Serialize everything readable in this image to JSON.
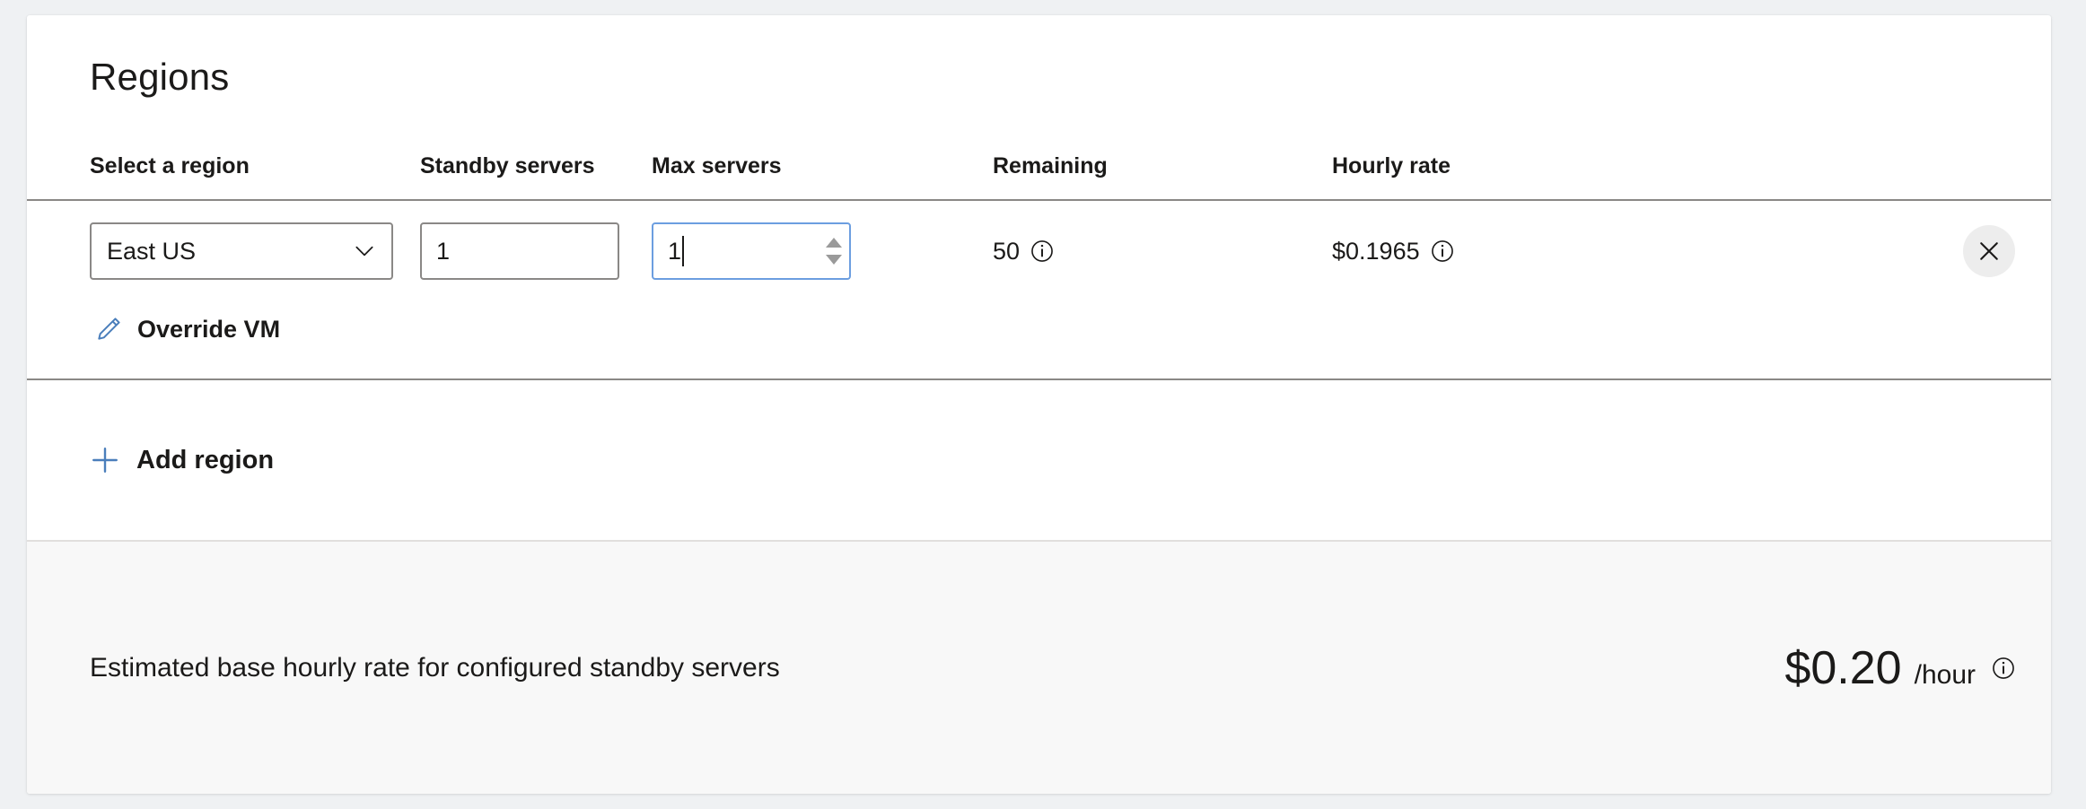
{
  "card": {
    "title": "Regions"
  },
  "table": {
    "headers": {
      "region": "Select a region",
      "standby": "Standby servers",
      "max": "Max servers",
      "remaining": "Remaining",
      "hourly_rate": "Hourly rate"
    },
    "rows": [
      {
        "region_value": "East US",
        "standby_value": "1",
        "max_value": "1",
        "remaining": "50",
        "hourly_rate": "$0.1965",
        "override_label": "Override VM",
        "remove_title": "Remove region"
      }
    ]
  },
  "actions": {
    "add_region_label": "Add region"
  },
  "footer": {
    "text": "Estimated base hourly rate for configured standby servers",
    "price": "$0.20",
    "unit": "/hour"
  },
  "icons": {
    "chevron_down": "chevron-down-icon",
    "info": "info-icon",
    "close": "close-icon",
    "pencil": "pencil-icon",
    "plus": "plus-icon",
    "spinner_up": "spinner-up-icon",
    "spinner_down": "spinner-down-icon"
  },
  "colors": {
    "page_background": "#eff1f3",
    "card_background": "#ffffff",
    "accent_blue": "#4a7ebb",
    "focus_border": "#6c9ee0",
    "text_primary": "#1b1a19",
    "border_gray": "#8a8886",
    "footer_background": "#f8f8f8"
  }
}
